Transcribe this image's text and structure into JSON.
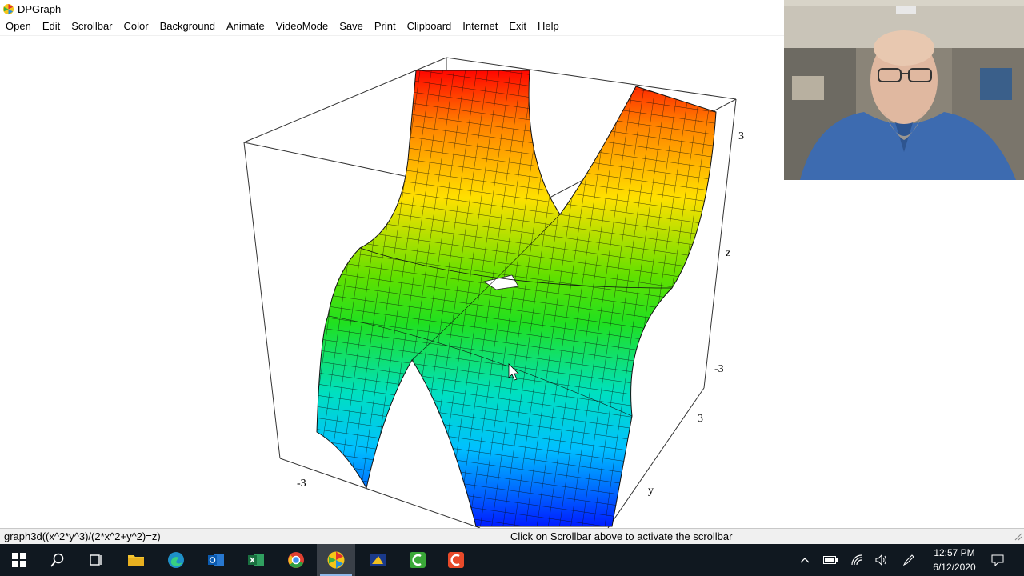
{
  "window": {
    "title": "DPGraph"
  },
  "menu": [
    "Open",
    "Edit",
    "Scrollbar",
    "Color",
    "Background",
    "Animate",
    "VideoMode",
    "Save",
    "Print",
    "Clipboard",
    "Internet",
    "Exit",
    "Help"
  ],
  "plot": {
    "tick_z_top": "3",
    "axis_z": "z",
    "tick_z_bottom": "-3",
    "tick_y_far": "3",
    "axis_y": "y",
    "tick_x_left": "-3"
  },
  "status": {
    "equation": "graph3d((x^2*y^3)/(2*x^2+y^2)=z)",
    "hint": "Click on Scrollbar above to activate the scrollbar"
  },
  "taskbar": {
    "time": "12:57 PM",
    "date": "6/12/2020",
    "apps": [
      "start-icon",
      "search-icon",
      "task-view-icon",
      "file-explorer-icon",
      "edge-icon",
      "outlook-icon",
      "excel-icon",
      "chrome-icon",
      "dpgraph-icon",
      "powerpoint-icon",
      "camtasia-icon",
      "camtasia-recorder-icon"
    ]
  }
}
